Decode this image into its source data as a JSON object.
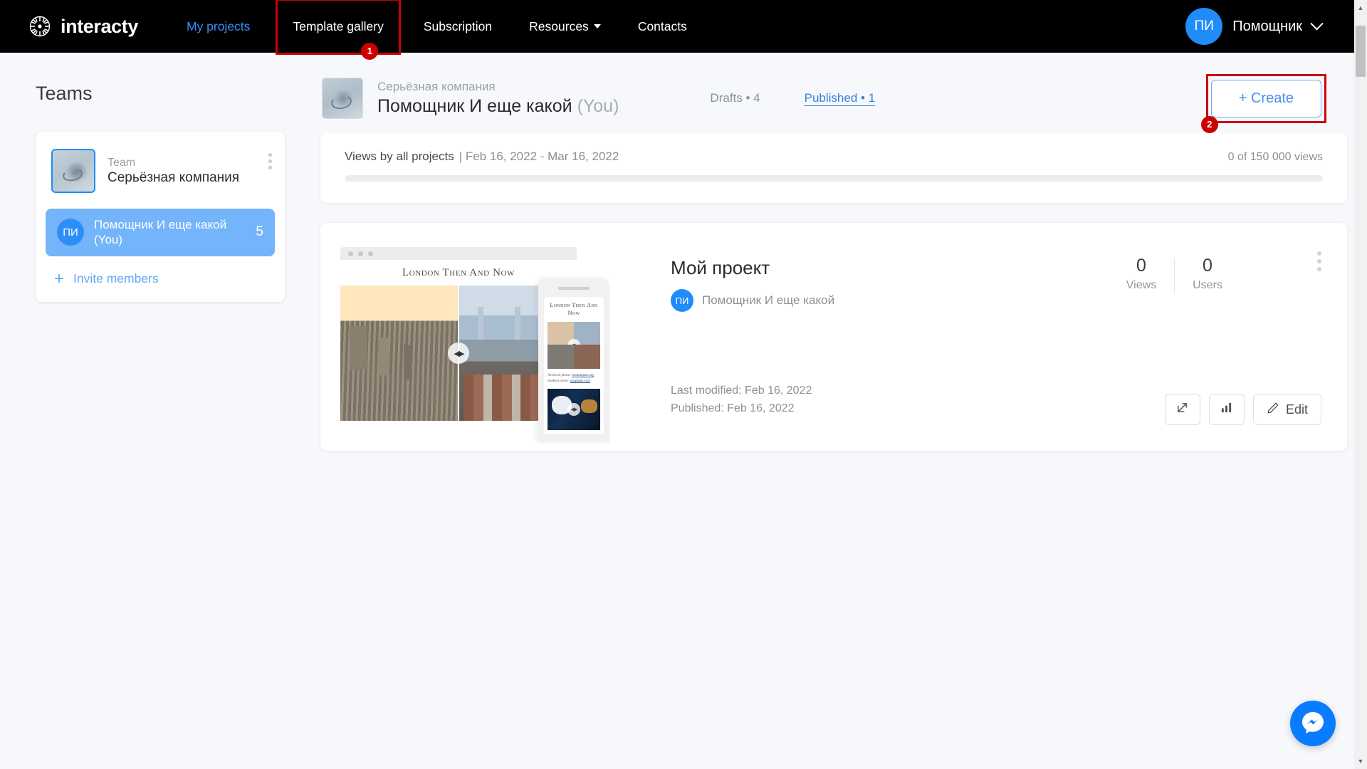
{
  "brand": {
    "name": "interacty",
    "logo_icon": "compass-rose-icon"
  },
  "nav": {
    "items": [
      {
        "label": "My projects",
        "style": "blue",
        "name": "nav-my-projects"
      },
      {
        "label": "Template gallery",
        "style": "white",
        "name": "nav-template-gallery",
        "highlight_badge": "1"
      },
      {
        "label": "Subscription",
        "style": "white",
        "name": "nav-subscription"
      },
      {
        "label": "Resources",
        "style": "white",
        "name": "nav-resources",
        "has_caret": true
      },
      {
        "label": "Contacts",
        "style": "white",
        "name": "nav-contacts"
      }
    ],
    "user": {
      "initials": "ПИ",
      "name": "Помощник",
      "chevron_icon": "chevron-down-icon"
    }
  },
  "sidebar": {
    "title": "Teams",
    "team": {
      "label": "Team",
      "name": "Серьёзная компания",
      "kebab_icon": "kebab-menu-icon"
    },
    "member": {
      "initials": "ПИ",
      "name": "Помощник И еще какой (You)",
      "count": "5"
    },
    "invite": {
      "plus_icon": "plus-icon",
      "label": "Invite members"
    }
  },
  "project_header": {
    "team_name": "Серьёзная компания",
    "owner_name": "Помощник И еще какой",
    "owner_suffix": "(You)",
    "tabs": [
      {
        "label": "Drafts • 4",
        "active": false,
        "name": "tab-drafts"
      },
      {
        "label": "Published • 1",
        "active": true,
        "name": "tab-published"
      }
    ],
    "create_button": "+ Create",
    "create_badge": "2"
  },
  "stats": {
    "label": "Views by all projects",
    "range": "| Feb 16, 2022 - Mar 16, 2022",
    "quota": "0 of 150 000 views",
    "progress_percent": 0
  },
  "project_card": {
    "preview": {
      "desktop_title": "London Then And Now",
      "phone_title": "London Then And Now",
      "phone_caption_prefix": "Archival photo: ",
      "phone_caption_link1": "londonpast.org",
      "phone_caption_mid": ", modern photo: ",
      "phone_caption_link2": "unsplash.com",
      "split_handle_icon": "before-after-slider-icon"
    },
    "name": "Мой проект",
    "author": {
      "initials": "ПИ",
      "name": "Помощник И еще какой"
    },
    "counters": [
      {
        "value": "0",
        "caption": "Views",
        "name": "counter-views"
      },
      {
        "value": "0",
        "caption": "Users",
        "name": "counter-users"
      }
    ],
    "last_modified": "Last modified: Feb 16, 2022",
    "published": "Published: Feb 16, 2022",
    "actions": [
      {
        "icon": "external-link-icon",
        "label": "",
        "name": "open-project-button"
      },
      {
        "icon": "bar-chart-icon",
        "label": "",
        "name": "project-stats-button"
      },
      {
        "icon": "pencil-icon",
        "label": "Edit",
        "name": "edit-project-button"
      }
    ],
    "kebab_icon": "kebab-menu-icon"
  },
  "fab": {
    "icon": "messenger-icon"
  },
  "colors": {
    "brand_black": "#000000",
    "accent_blue": "#1f8cf9",
    "link_blue": "#3b8cf5",
    "highlight_red": "#cc0000",
    "page_bg": "#f7f8fc",
    "member_row": "#73b4fa",
    "messenger_blue": "#0a7cff"
  }
}
